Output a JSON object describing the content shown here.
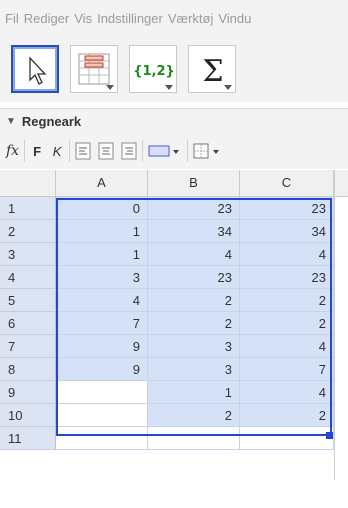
{
  "menu": [
    "Fil",
    "Rediger",
    "Vis",
    "Indstillinger",
    "Værktøj",
    "Vindu"
  ],
  "tools": [
    {
      "name": "move-tool",
      "icon": "arrow-cursor-icon"
    },
    {
      "name": "spreadsheet-list-tool",
      "icon": "create-list-icon"
    },
    {
      "name": "list-tool",
      "icon": "list-braces-icon",
      "label": "{1,2}"
    },
    {
      "name": "sum-tool",
      "icon": "sigma-icon",
      "label": "Σ"
    }
  ],
  "panel": {
    "title": "Regneark"
  },
  "stylebar": {
    "fx": "fx",
    "bold": "F",
    "italic": "K"
  },
  "columns": [
    "A",
    "B",
    "C"
  ],
  "rows": [
    {
      "n": "1",
      "a": "0",
      "b": "23",
      "c": "23"
    },
    {
      "n": "2",
      "a": "1",
      "b": "34",
      "c": "34"
    },
    {
      "n": "3",
      "a": "1",
      "b": "4",
      "c": "4"
    },
    {
      "n": "4",
      "a": "3",
      "b": "23",
      "c": "23"
    },
    {
      "n": "5",
      "a": "4",
      "b": "2",
      "c": "2"
    },
    {
      "n": "6",
      "a": "7",
      "b": "2",
      "c": "2"
    },
    {
      "n": "7",
      "a": "9",
      "b": "3",
      "c": "4"
    },
    {
      "n": "8",
      "a": "9",
      "b": "3",
      "c": "7"
    },
    {
      "n": "9",
      "a": "",
      "b": "1",
      "c": "4"
    },
    {
      "n": "10",
      "a": "",
      "b": "2",
      "c": "2"
    },
    {
      "n": "11",
      "a": "",
      "b": "",
      "c": ""
    }
  ],
  "colors": {
    "selection_border": "#2545d6",
    "selection_fill": "#d5e1f7",
    "list_green": "#1a8c1a"
  }
}
